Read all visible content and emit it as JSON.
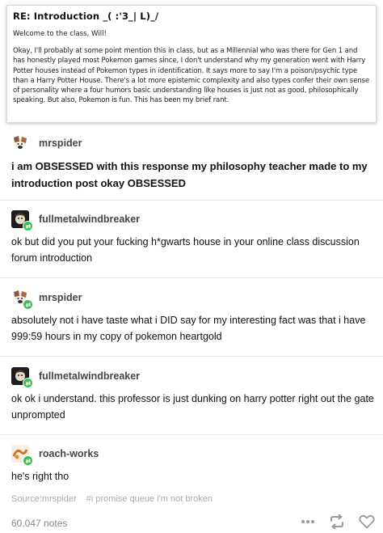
{
  "quote": {
    "title": "RE: Introduction _( :'3_| L)_/",
    "greeting": "Welcome to the class, Will!",
    "body": "Okay, I'll probably  at some point mention this in class, but as a Millennial who was there for Gen 1 and has honestly played most Pokemon games since, I don't understand why my generation went with Harry Potter houses instead of Pokemon types in identification. It says more to say I'm a poison/psychic type than a Harry Potter House. There's a lot more epistemic complexity and also types confer their own sense of personality where a four humors basic understanding like houses is just not as good, philosophically speaking. But also, Pokemon is fun. This has been my brief rant."
  },
  "posts": [
    {
      "username": "mrspider",
      "text": "i am OBSESSED with this response my philosophy teacher made to my introduction post okay OBSESSED"
    },
    {
      "username": "fullmetalwindbreaker",
      "text": "ok but did you put your fucking h*gwarts house in your online class discussion forum introduction"
    },
    {
      "username": "mrspider",
      "text": "absolutely not i have taste what i DID say for my interesting fact was that i have 999:59 hours in my copy of pokemon heartgold"
    },
    {
      "username": "fullmetalwindbreaker",
      "text": "ok ok i understand. this professor is just dunking on harry potter right out the gate unprompted"
    },
    {
      "username": "roach-works",
      "text": "he's right tho"
    }
  ],
  "footer": {
    "source": "Source:mrspider",
    "tag": "#i promise queue i'm not broken",
    "notes": "60,047 notes"
  },
  "icons": {
    "more": "more-options-icon",
    "reblog": "reblog-icon",
    "like": "heart-icon"
  },
  "colors": {
    "reblog_badge": "#3fbd54",
    "muted_text": "#aaaaaa"
  }
}
